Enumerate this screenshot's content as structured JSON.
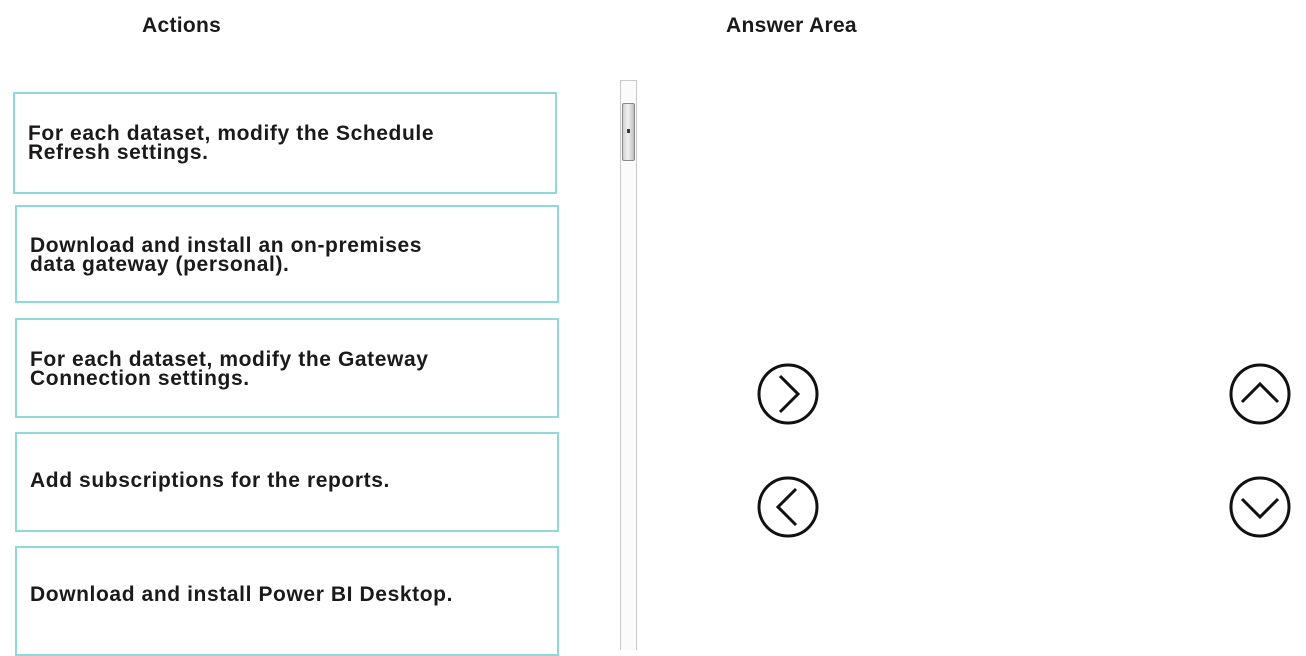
{
  "headings": {
    "actions": "Actions",
    "answer_area": "Answer Area"
  },
  "actions": [
    {
      "lines": [
        "For each dataset, modify the Schedule",
        "Refresh settings."
      ]
    },
    {
      "lines": [
        "Download and install an on-premises",
        "data gateway (personal)."
      ]
    },
    {
      "lines": [
        "For each dataset, modify the Gateway",
        "Connection settings."
      ]
    },
    {
      "lines": [
        "Add subscriptions for the reports."
      ]
    },
    {
      "lines": [
        "Download and install Power BI Desktop."
      ]
    }
  ],
  "controls": {
    "move_right_icon": "chevron-right-circle-icon",
    "move_left_icon": "chevron-left-circle-icon",
    "move_up_icon": "chevron-up-circle-icon",
    "move_down_icon": "chevron-down-circle-icon"
  },
  "colors": {
    "item_border": "#8fd9dc",
    "text": "#1a1a1a"
  }
}
